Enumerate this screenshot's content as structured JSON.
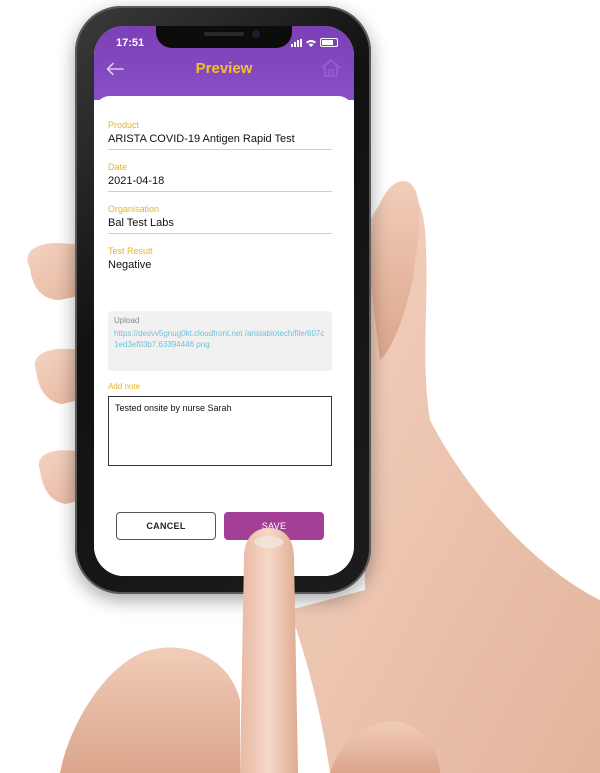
{
  "status_bar": {
    "time": "17:51"
  },
  "header": {
    "title": "Preview",
    "back_icon": "arrow-left-icon",
    "home_icon": "home-icon",
    "background_color": "#7b3fb6",
    "title_color": "#f2c12e"
  },
  "form": {
    "fields": [
      {
        "label": "Product",
        "value": "ARISTA COVID-19 Antigen Rapid Test"
      },
      {
        "label": "Date",
        "value": "2021-04-18"
      },
      {
        "label": "Organisation",
        "value": "Bal Test Labs"
      },
      {
        "label": "Test Result",
        "value": "Negative"
      }
    ],
    "upload": {
      "label": "Upload",
      "link": "https://desvv5gnug0kt.cloudfront.net /aristabiotech/file/607c1ed3ef03b7.63394446 png"
    },
    "note": {
      "label": "Add note",
      "value": "Tested onsite by nurse Sarah"
    }
  },
  "actions": {
    "cancel_label": "CANCEL",
    "save_label": "SAVE",
    "save_color": "#a33f96"
  }
}
